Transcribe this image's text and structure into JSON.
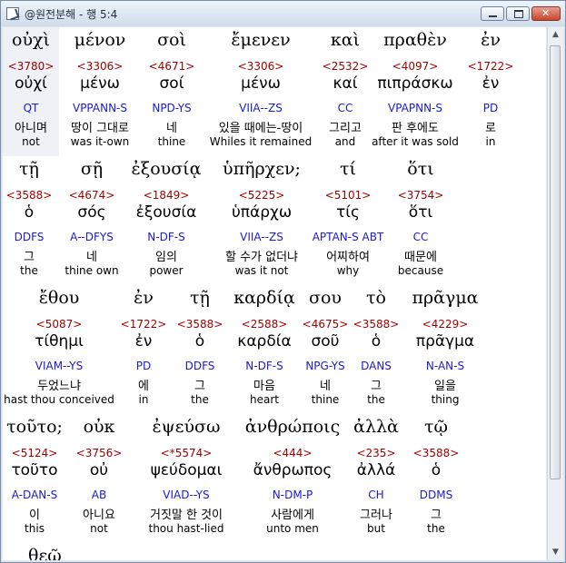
{
  "window": {
    "title": "@원전분해 - 행 5:4"
  },
  "rows": [
    [
      {
        "greek": "οὐχὶ",
        "strong": "<3780>",
        "lemma": "οὐχί",
        "parse": "QT",
        "korean": "아니며",
        "english": "not",
        "selected": true
      },
      {
        "greek": "μένον",
        "strong": "<3306>",
        "lemma": "μένω",
        "parse": "VPPANN-S",
        "korean": "땅이 그대로",
        "english": "was it-own"
      },
      {
        "greek": "σοὶ",
        "strong": "<4671>",
        "lemma": "σοί",
        "parse": "NPD-YS",
        "korean": "네",
        "english": "thine"
      },
      {
        "greek": "ἔμενεν",
        "strong": "<3306>",
        "lemma": "μένω",
        "parse": "VIIA--ZS",
        "korean": "있을 때에는-땅이",
        "english": "Whiles it remained"
      },
      {
        "greek": "καὶ",
        "strong": "<2532>",
        "lemma": "καί",
        "parse": "CC",
        "korean": "그리고",
        "english": "and"
      },
      {
        "greek": "πραθὲν",
        "strong": "<4097>",
        "lemma": "πιπράσκω",
        "parse": "VPAPNN-S",
        "korean": "판 후에도",
        "english": "after it was sold"
      },
      {
        "greek": "ἐν",
        "strong": "<1722>",
        "lemma": "ἐν",
        "parse": "PD",
        "korean": "로",
        "english": "in"
      }
    ],
    [
      {
        "greek": "τῇ",
        "strong": "<3588>",
        "lemma": "ὁ",
        "parse": "DDFS",
        "korean": "그",
        "english": "the"
      },
      {
        "greek": "σῇ",
        "strong": "<4674>",
        "lemma": "σός",
        "parse": "A--DFYS",
        "korean": "네",
        "english": "thine own"
      },
      {
        "greek": "ἐξουσίᾳ",
        "strong": "<1849>",
        "lemma": "ἐξουσία",
        "parse": "N-DF-S",
        "korean": "임의",
        "english": "power"
      },
      {
        "greek": "ὑπῆρχεν;",
        "strong": "<5225>",
        "lemma": "ὑπάρχω",
        "parse": "VIIA--ZS",
        "korean": "할 수가 없더냐",
        "english": "was it not"
      },
      {
        "greek": "τί",
        "strong": "<5101>",
        "lemma": "τίς",
        "parse": "APTAN-S ABT",
        "korean": "어찌하여",
        "english": "why"
      },
      {
        "greek": "ὅτι",
        "strong": "<3754>",
        "lemma": "ὅτι",
        "parse": "CC",
        "korean": "때문에",
        "english": "because"
      }
    ],
    [
      {
        "greek": "ἔθου",
        "strong": "<5087>",
        "lemma": "τίθημι",
        "parse": "VIAM--YS",
        "korean": "두었느냐",
        "english": "hast thou conceived"
      },
      {
        "greek": "ἐν",
        "strong": "<1722>",
        "lemma": "ἐν",
        "parse": "PD",
        "korean": "에",
        "english": "in"
      },
      {
        "greek": "τῇ",
        "strong": "<3588>",
        "lemma": "ὁ",
        "parse": "DDFS",
        "korean": "그",
        "english": "the"
      },
      {
        "greek": "καρδίᾳ",
        "strong": "<2588>",
        "lemma": "καρδία",
        "parse": "N-DF-S",
        "korean": "마음",
        "english": "heart"
      },
      {
        "greek": "σου",
        "strong": "<4675>",
        "lemma": "σοῦ",
        "parse": "NPG-YS",
        "korean": "네",
        "english": "thine"
      },
      {
        "greek": "τὸ",
        "strong": "<3588>",
        "lemma": "ὁ",
        "parse": "DANS",
        "korean": "그",
        "english": "the"
      },
      {
        "greek": "πρᾶγμα",
        "strong": "<4229>",
        "lemma": "πρᾶγμα",
        "parse": "N-AN-S",
        "korean": "일을",
        "english": "thing"
      }
    ],
    [
      {
        "greek": "τοῦτο;",
        "strong": "<5124>",
        "lemma": "τοῦτο",
        "parse": "A-DAN-S",
        "korean": "이",
        "english": "this"
      },
      {
        "greek": "οὐκ",
        "strong": "<3756>",
        "lemma": "οὐ",
        "parse": "AB",
        "korean": "아니요",
        "english": "not"
      },
      {
        "greek": "ἐψεύσω",
        "strong": "<*5574>",
        "lemma": "ψεύδομαι",
        "parse": "VIAD--YS",
        "korean": "거짓말 한 것이",
        "english": "thou hast-lied"
      },
      {
        "greek": "ἀνθρώποις",
        "strong": "<444>",
        "lemma": "ἄνθρωπος",
        "parse": "N-DM-P",
        "korean": "사람에게",
        "english": "unto men"
      },
      {
        "greek": "ἀλλὰ",
        "strong": "<235>",
        "lemma": "ἀλλά",
        "parse": "CH",
        "korean": "그러나",
        "english": "but"
      },
      {
        "greek": "τῷ",
        "strong": "<3588>",
        "lemma": "ὁ",
        "parse": "DDMS",
        "korean": "그",
        "english": "the"
      }
    ]
  ],
  "next_row_partial": "θεῷ"
}
